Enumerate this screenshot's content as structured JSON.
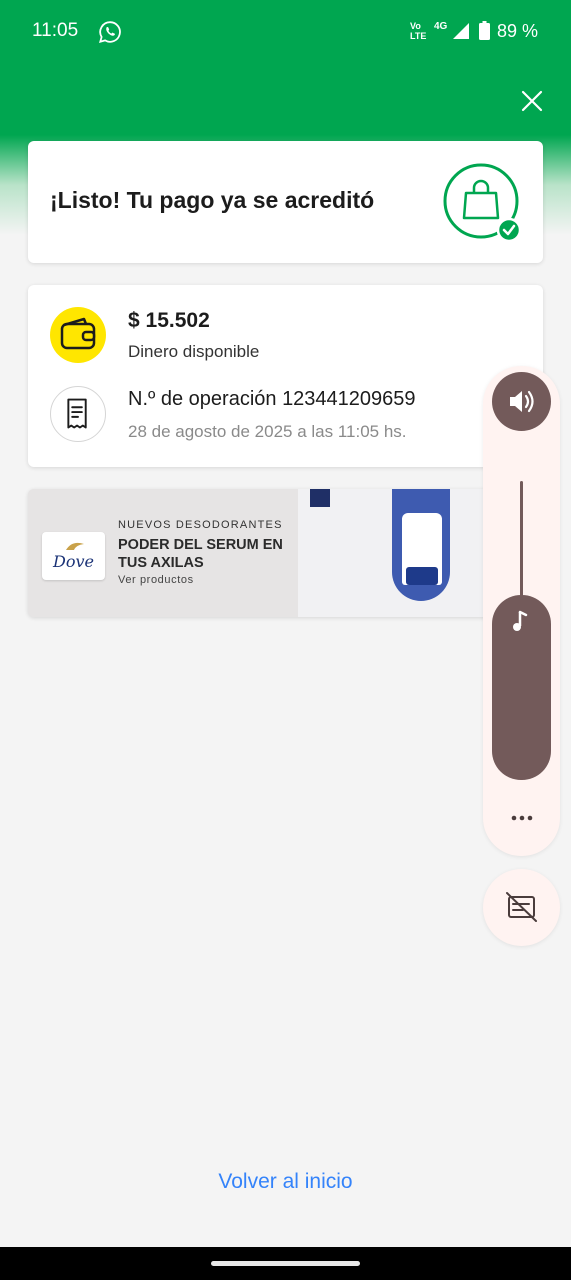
{
  "status_bar": {
    "time": "11:05",
    "network_top": "Vo",
    "network_bottom": "LTE",
    "network_type": "4G",
    "battery": "89 %"
  },
  "header": {
    "close_icon": "close-icon",
    "color": "#00a650"
  },
  "success_card": {
    "title": "¡Listo! Tu pago ya se acreditó",
    "icon": "shopping-bag-check-icon"
  },
  "details": {
    "amount": "$ 15.502",
    "amount_label": "Dinero disponible",
    "operation": "N.º de operación 123441209659",
    "date": "28 de agosto de 2025 a las 11:05 hs.",
    "wallet_icon": "wallet-icon",
    "receipt_icon": "receipt-icon"
  },
  "ad": {
    "brand": "Dove",
    "kicker": "NUEVOS DESODORANTES",
    "headline": "PODER DEL SERUM EN TUS AXILAS",
    "cta": "Ver productos"
  },
  "volume_panel": {
    "level_percent": 55,
    "speaker_icon": "speaker-icon",
    "music_icon": "music-note-icon",
    "more_icon": "more-horizontal-icon",
    "captions_icon": "captions-off-icon"
  },
  "footer": {
    "back_link": "Volver al inicio"
  }
}
